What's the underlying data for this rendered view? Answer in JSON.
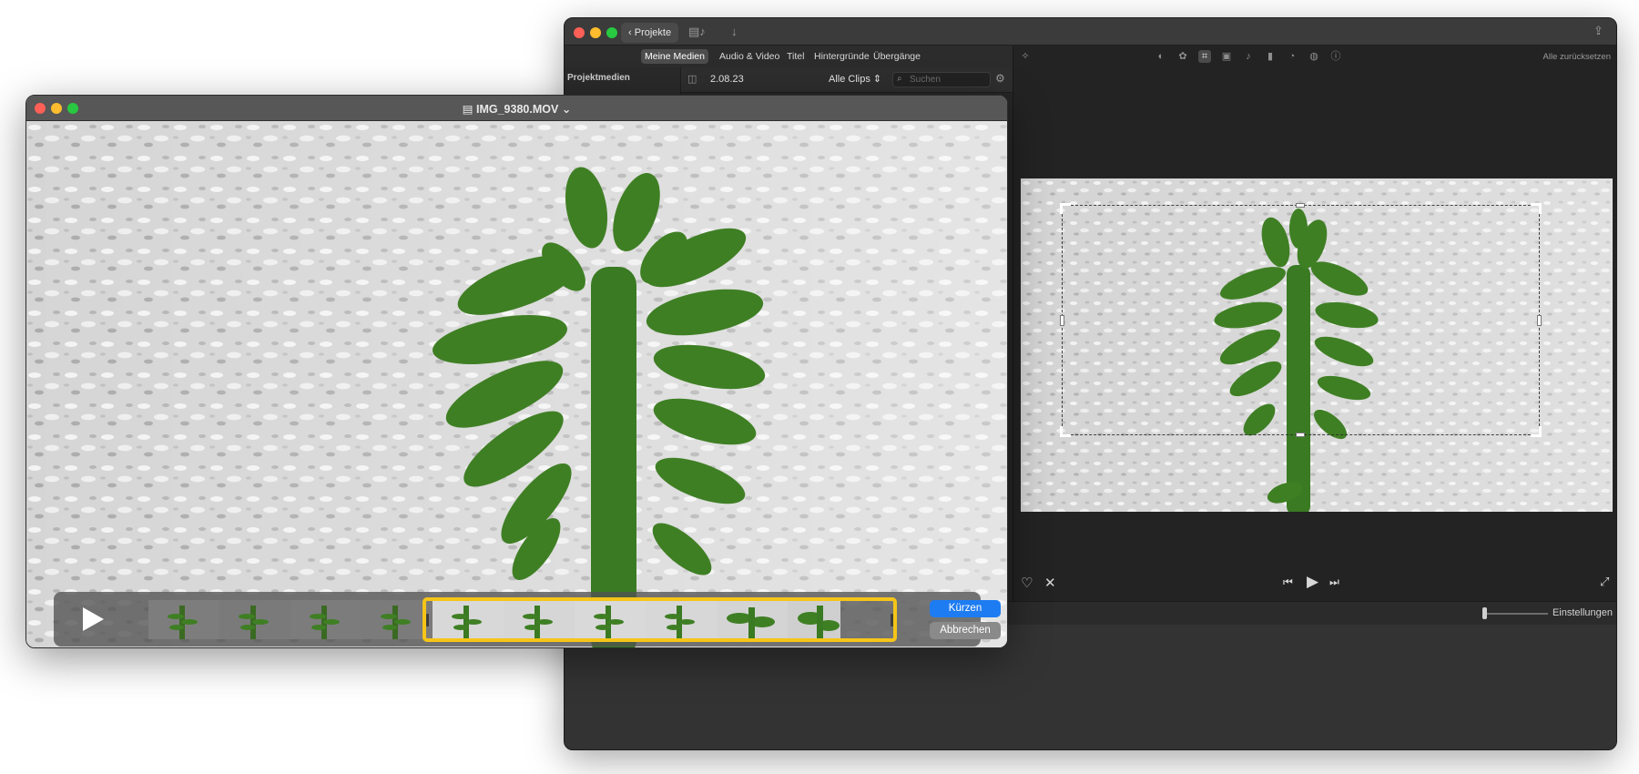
{
  "imovie": {
    "toolbar": {
      "back_label": "Projekte"
    },
    "tabs": [
      "Meine Medien",
      "Audio & Video",
      "Titel",
      "Hintergründe",
      "Übergänge"
    ],
    "active_tab": "Meine Medien",
    "sidebar": {
      "title": "Projektmedien"
    },
    "library": {
      "date": "2.08.23",
      "filter": "Alle Clips",
      "search_placeholder": "Suchen"
    },
    "adjust": {
      "reset_all": "Alle zurücksetzen"
    },
    "timeline": {
      "settings_label": "Einstellungen"
    }
  },
  "quicktime": {
    "title": "IMG_9380.MOV",
    "trim": {
      "confirm": "Kürzen",
      "cancel": "Abbrechen"
    }
  },
  "colors": {
    "trim_accent": "#f5c518",
    "primary_button": "#1e7cf2",
    "dark_panel": "#262626"
  }
}
